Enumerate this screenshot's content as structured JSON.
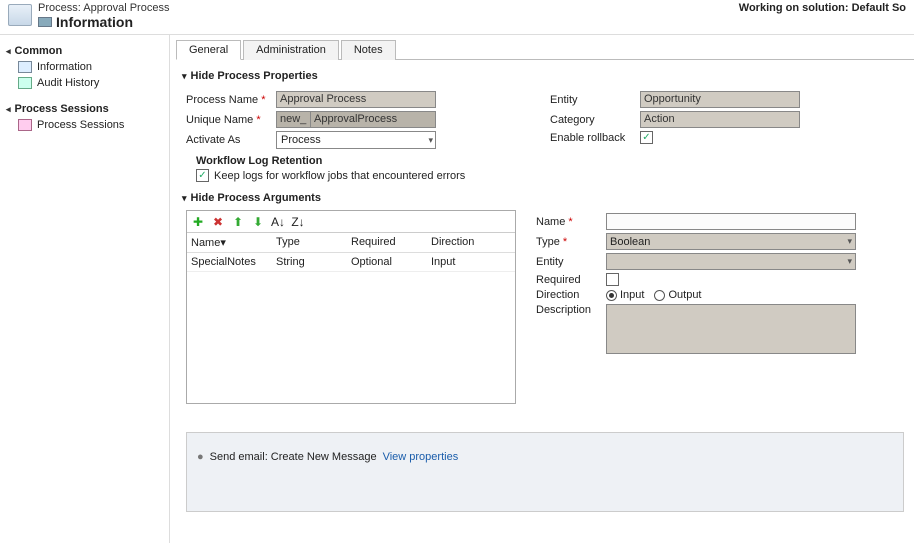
{
  "header": {
    "process_label": "Process: Approval Process",
    "title": "Information",
    "working": "Working on solution: Default So"
  },
  "sidebar": {
    "sections": [
      {
        "title": "Common",
        "items": [
          {
            "label": "Information"
          },
          {
            "label": "Audit History"
          }
        ]
      },
      {
        "title": "Process Sessions",
        "items": [
          {
            "label": "Process Sessions"
          }
        ]
      }
    ]
  },
  "tabs": {
    "items": [
      "General",
      "Administration",
      "Notes"
    ],
    "active": 0
  },
  "properties_section": {
    "title": "Hide Process Properties",
    "left": {
      "process_name_label": "Process Name",
      "process_name_value": "Approval Process",
      "unique_name_label": "Unique Name",
      "unique_name_prefix": "new_",
      "unique_name_value": "ApprovalProcess",
      "activate_as_label": "Activate As",
      "activate_as_value": "Process",
      "workflow_log_heading": "Workflow Log Retention",
      "keep_logs_label": "Keep logs for workflow jobs that encountered errors"
    },
    "right": {
      "entity_label": "Entity",
      "entity_value": "Opportunity",
      "category_label": "Category",
      "category_value": "Action",
      "enable_rollback_label": "Enable rollback"
    }
  },
  "arguments_section": {
    "title": "Hide Process Arguments",
    "grid": {
      "headers": [
        "Name▾",
        "Type",
        "Required",
        "Direction"
      ],
      "rows": [
        {
          "name": "SpecialNotes",
          "type": "String",
          "required": "Optional",
          "direction": "Input"
        }
      ]
    },
    "detail": {
      "name_label": "Name",
      "name_value": "",
      "type_label": "Type",
      "type_value": "Boolean",
      "entity_label": "Entity",
      "entity_value": "",
      "required_label": "Required",
      "direction_label": "Direction",
      "direction_input": "Input",
      "direction_output": "Output",
      "description_label": "Description"
    }
  },
  "bottom": {
    "step_text": "Send email:  Create New Message",
    "view_props": "View properties"
  }
}
